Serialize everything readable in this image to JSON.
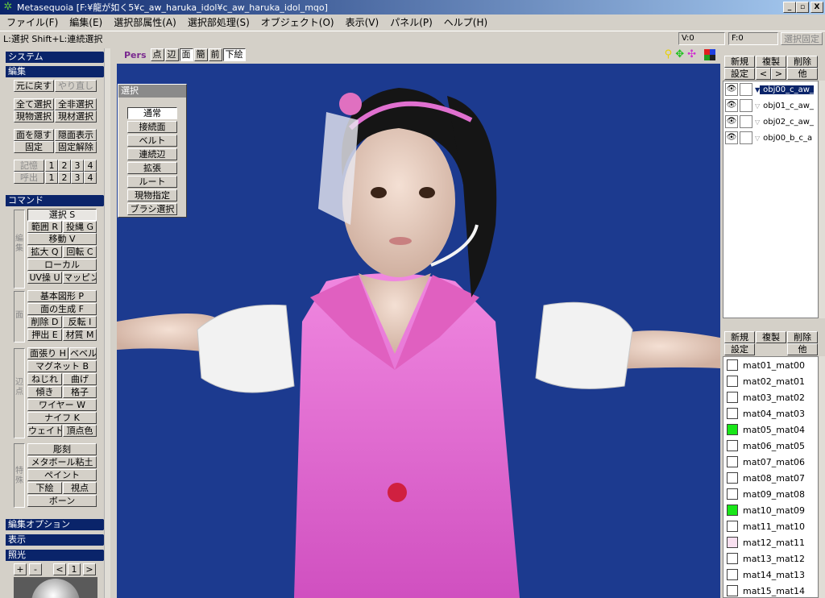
{
  "window": {
    "title": "Metasequoia [F:¥龍が如く5¥c_aw_haruka_idol¥c_aw_haruka_idol_mqo]",
    "min": "_",
    "max": "▫",
    "close": "X"
  },
  "menu": [
    "ファイル(F)",
    "編集(E)",
    "選択部属性(A)",
    "選択部処理(S)",
    "オブジェクト(O)",
    "表示(V)",
    "パネル(P)",
    "ヘルプ(H)"
  ],
  "status": {
    "hint": "L:選択  Shift+L:連続選択",
    "v": "V:0",
    "f": "F:0",
    "lock": "選択固定"
  },
  "left": {
    "system": "システム",
    "edit": "編集",
    "undo": "元に戻す",
    "redo": "やり直し",
    "select_all": "全て選択",
    "deselect_all": "全非選択",
    "select_obj": "現物選択",
    "select_mat": "現材選択",
    "hide_face": "面を隠す",
    "show_hidden": "隠面表示",
    "fix": "固定",
    "unfix": "固定解除",
    "memory": "記憶",
    "recall": "呼出",
    "nums": [
      "1",
      "2",
      "3",
      "4"
    ],
    "command": "コマンド",
    "cmd_edit_label": "編集",
    "cmd_face_label": "面",
    "cmd_vertex_label": "辺点",
    "cmd_special_label": "特殊",
    "select": "選択 S",
    "range": "範囲 R",
    "lasso": "投縄 G",
    "move": "移動 V",
    "scale": "拡大 Q",
    "rotate": "回転 C",
    "local": "ローカル",
    "uv": "UV操 U",
    "mapping": "マッピング",
    "primitive": "基本図形 P",
    "gen_face": "面の生成 F",
    "delete": "削除 D",
    "flip": "反転 I",
    "extrude": "押出 E",
    "material": "材質 M",
    "knife_h": "面張り H",
    "bevel": "ベベル",
    "magnet": "マグネット B",
    "twist": "ねじれ",
    "bend": "曲げ",
    "tilt": "傾き",
    "lattice": "格子",
    "wire": "ワイヤー W",
    "knife": "ナイフ K",
    "weight": "ウェイト",
    "vcolor": "頂点色",
    "sculpt": "彫刻",
    "metaball": "メタボール粘土",
    "paint": "ペイント",
    "underlay": "下絵",
    "viewpoint": "視点",
    "bone": "ボーン",
    "edit_option": "編集オプション",
    "display": "表示",
    "lighting": "照光",
    "plus": "+",
    "minus": "-",
    "prev": "<",
    "page": "1",
    "next": ">"
  },
  "viewport": {
    "mode": "Pers",
    "buttons": [
      "点",
      "辺",
      "面",
      "簡",
      "前",
      "下絵"
    ],
    "active": [
      "面",
      "下絵"
    ]
  },
  "select_panel": {
    "title": "選択",
    "options": [
      "通常",
      "接続面",
      "ベルト",
      "連続辺",
      "拡張",
      "ルート",
      "現物指定",
      "ブラシ選択"
    ],
    "active": "通常"
  },
  "right": {
    "new": "新規",
    "dup": "複製",
    "del": "削除",
    "settings": "設定",
    "prev": "<",
    "next": ">",
    "other": "他",
    "objects": [
      {
        "name": "obj00_c_aw_",
        "selected": true
      },
      {
        "name": "obj01_c_aw_",
        "selected": false
      },
      {
        "name": "obj02_c_aw_",
        "selected": false
      },
      {
        "name": "obj00_b_c_a",
        "selected": false
      }
    ],
    "materials": [
      {
        "name": "mat01_mat00",
        "color": "#ffffff"
      },
      {
        "name": "mat02_mat01",
        "color": "#ffffff"
      },
      {
        "name": "mat03_mat02",
        "color": "#ffffff"
      },
      {
        "name": "mat04_mat03",
        "color": "#ffffff"
      },
      {
        "name": "mat05_mat04",
        "color": "#19e619"
      },
      {
        "name": "mat06_mat05",
        "color": "#ffffff"
      },
      {
        "name": "mat07_mat06",
        "color": "#ffffff"
      },
      {
        "name": "mat08_mat07",
        "color": "#ffffff"
      },
      {
        "name": "mat09_mat08",
        "color": "#ffffff"
      },
      {
        "name": "mat10_mat09",
        "color": "#19e619"
      },
      {
        "name": "mat11_mat10",
        "color": "#ffffff"
      },
      {
        "name": "mat12_mat11",
        "color": "#f8e0f0"
      },
      {
        "name": "mat13_mat12",
        "color": "#ffffff"
      },
      {
        "name": "mat14_mat13",
        "color": "#ffffff"
      },
      {
        "name": "mat15_mat14",
        "color": "#ffffff"
      }
    ]
  }
}
